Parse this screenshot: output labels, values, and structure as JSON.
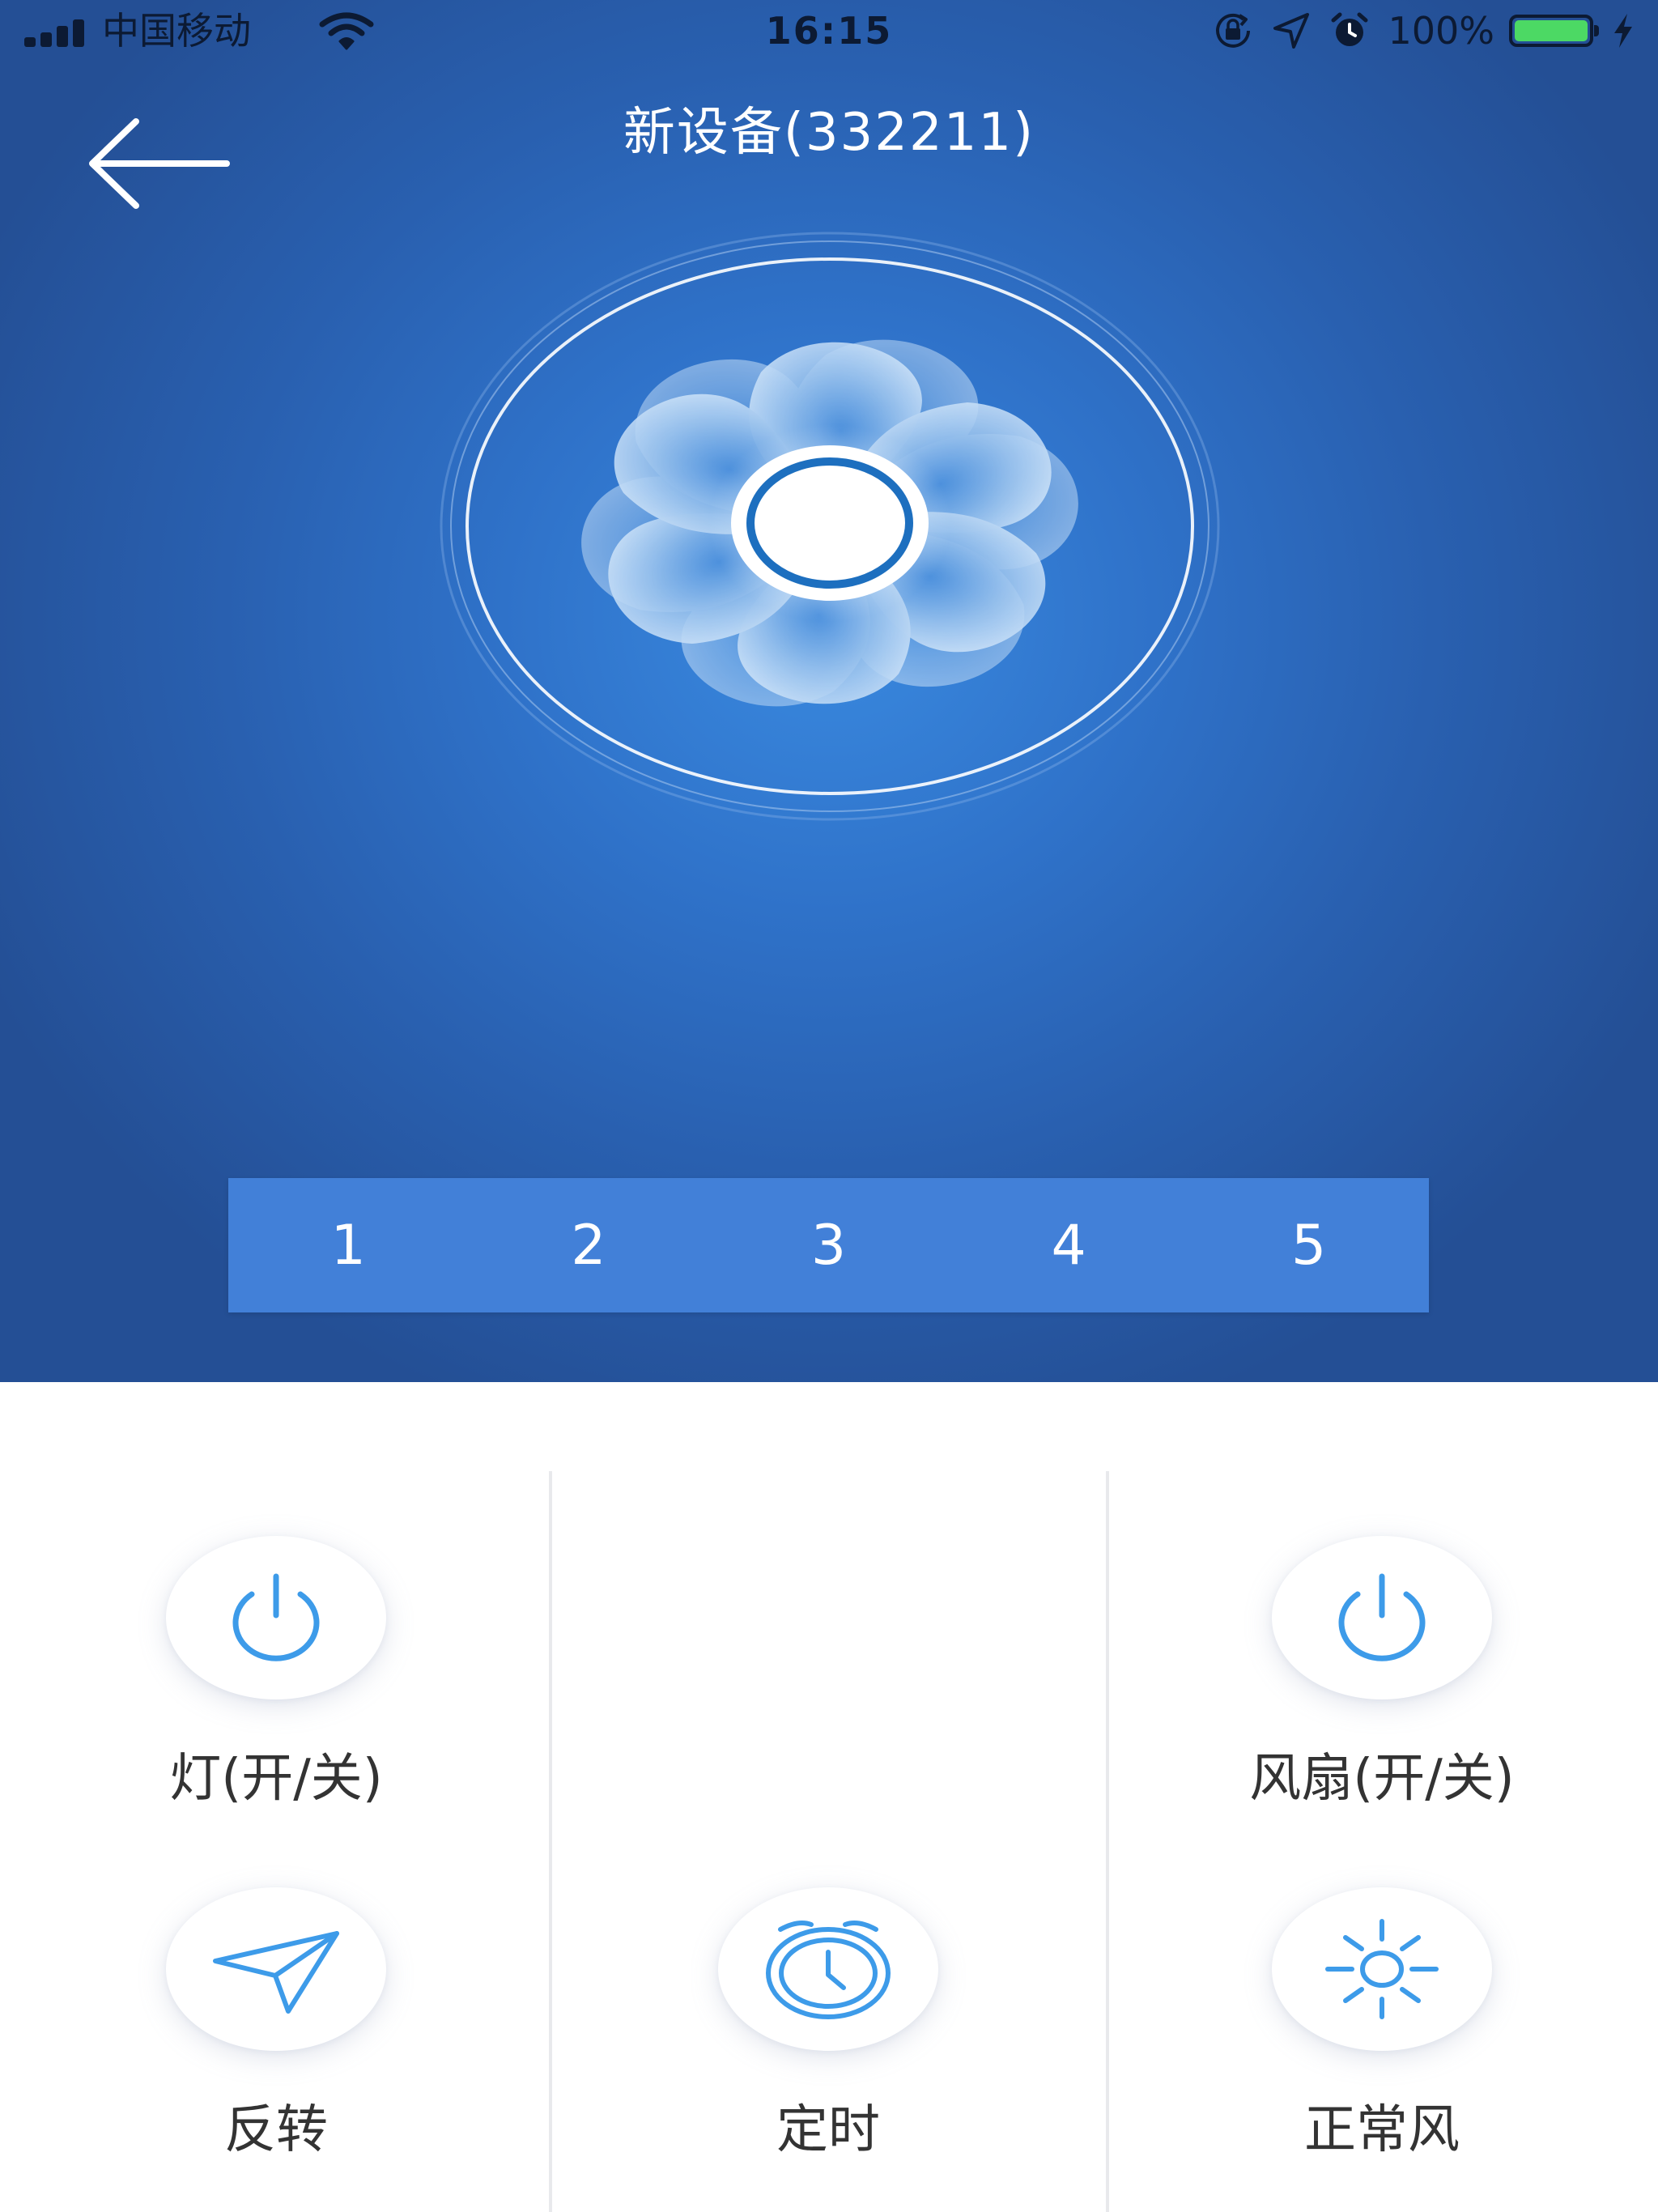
{
  "status_bar": {
    "carrier": "中国移动",
    "time": "16:15",
    "battery": "100%",
    "battery_level": 1.0,
    "icons": [
      "signal-icon",
      "wifi-icon",
      "rotation-lock-icon",
      "location-icon",
      "alarm-icon",
      "battery-icon",
      "charging-icon"
    ]
  },
  "header": {
    "title": "新设备(332211)",
    "back_icon": "back-arrow-icon"
  },
  "fan": {
    "icon": "fan-icon"
  },
  "speed_levels": [
    "1",
    "2",
    "3",
    "4",
    "5"
  ],
  "controls": {
    "light_toggle": {
      "label": "灯(开/关)",
      "icon": "power-icon"
    },
    "fan_toggle": {
      "label": "风扇(开/关)",
      "icon": "power-icon"
    },
    "reverse": {
      "label": "反转",
      "icon": "paper-plane-icon"
    },
    "timer": {
      "label": "定时",
      "icon": "alarm-clock-icon"
    },
    "normal_wind": {
      "label": "正常风",
      "icon": "sun-icon"
    }
  },
  "colors": {
    "header_blue": "#2f72c9",
    "speed_bar": "#4280d8",
    "icon_blue": "#3d9be9",
    "battery_green": "#4cd964"
  }
}
